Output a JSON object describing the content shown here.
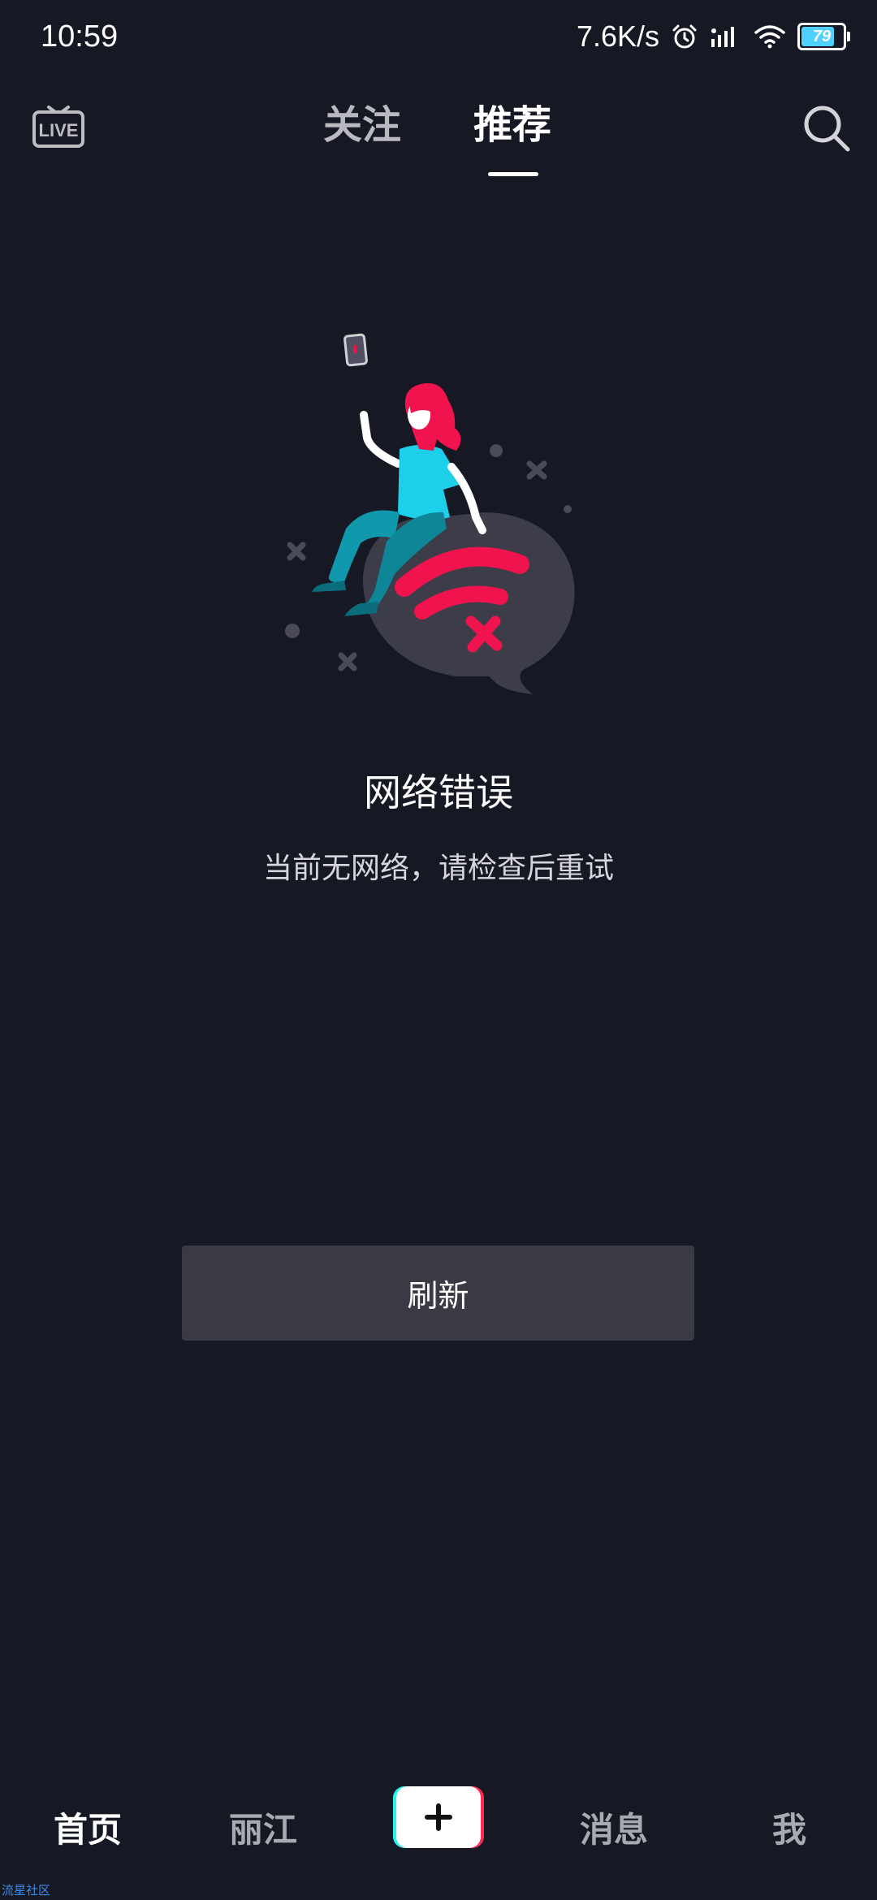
{
  "status_bar": {
    "time": "10:59",
    "network_speed": "7.6K/s",
    "battery_level": "79",
    "battery_fraction": 0.79,
    "icons": [
      "alarm-icon",
      "signal-icon",
      "wifi-icon",
      "battery-icon"
    ]
  },
  "top_nav": {
    "live_icon": "live-tv-icon",
    "tabs": [
      {
        "label": "关注",
        "active": false
      },
      {
        "label": "推荐",
        "active": true
      }
    ],
    "search_icon": "search-icon"
  },
  "empty_state": {
    "illustration": "girl-on-no-wifi-bubble-illustration",
    "title": "网络错误",
    "subtitle": "当前无网络，请检查后重试",
    "refresh_label": "刷新"
  },
  "bottom_nav": {
    "items": [
      {
        "label": "首页",
        "active": true
      },
      {
        "label": "丽江",
        "active": false
      },
      {
        "label": "消息",
        "active": false
      },
      {
        "label": "我",
        "active": false
      }
    ],
    "create_icon": "plus-icon"
  },
  "watermark": "流星社区",
  "colors": {
    "background": "#161823",
    "button_bg": "#3a3a44",
    "accent_red": "#fe2c55",
    "accent_cyan": "#25f4ee"
  }
}
